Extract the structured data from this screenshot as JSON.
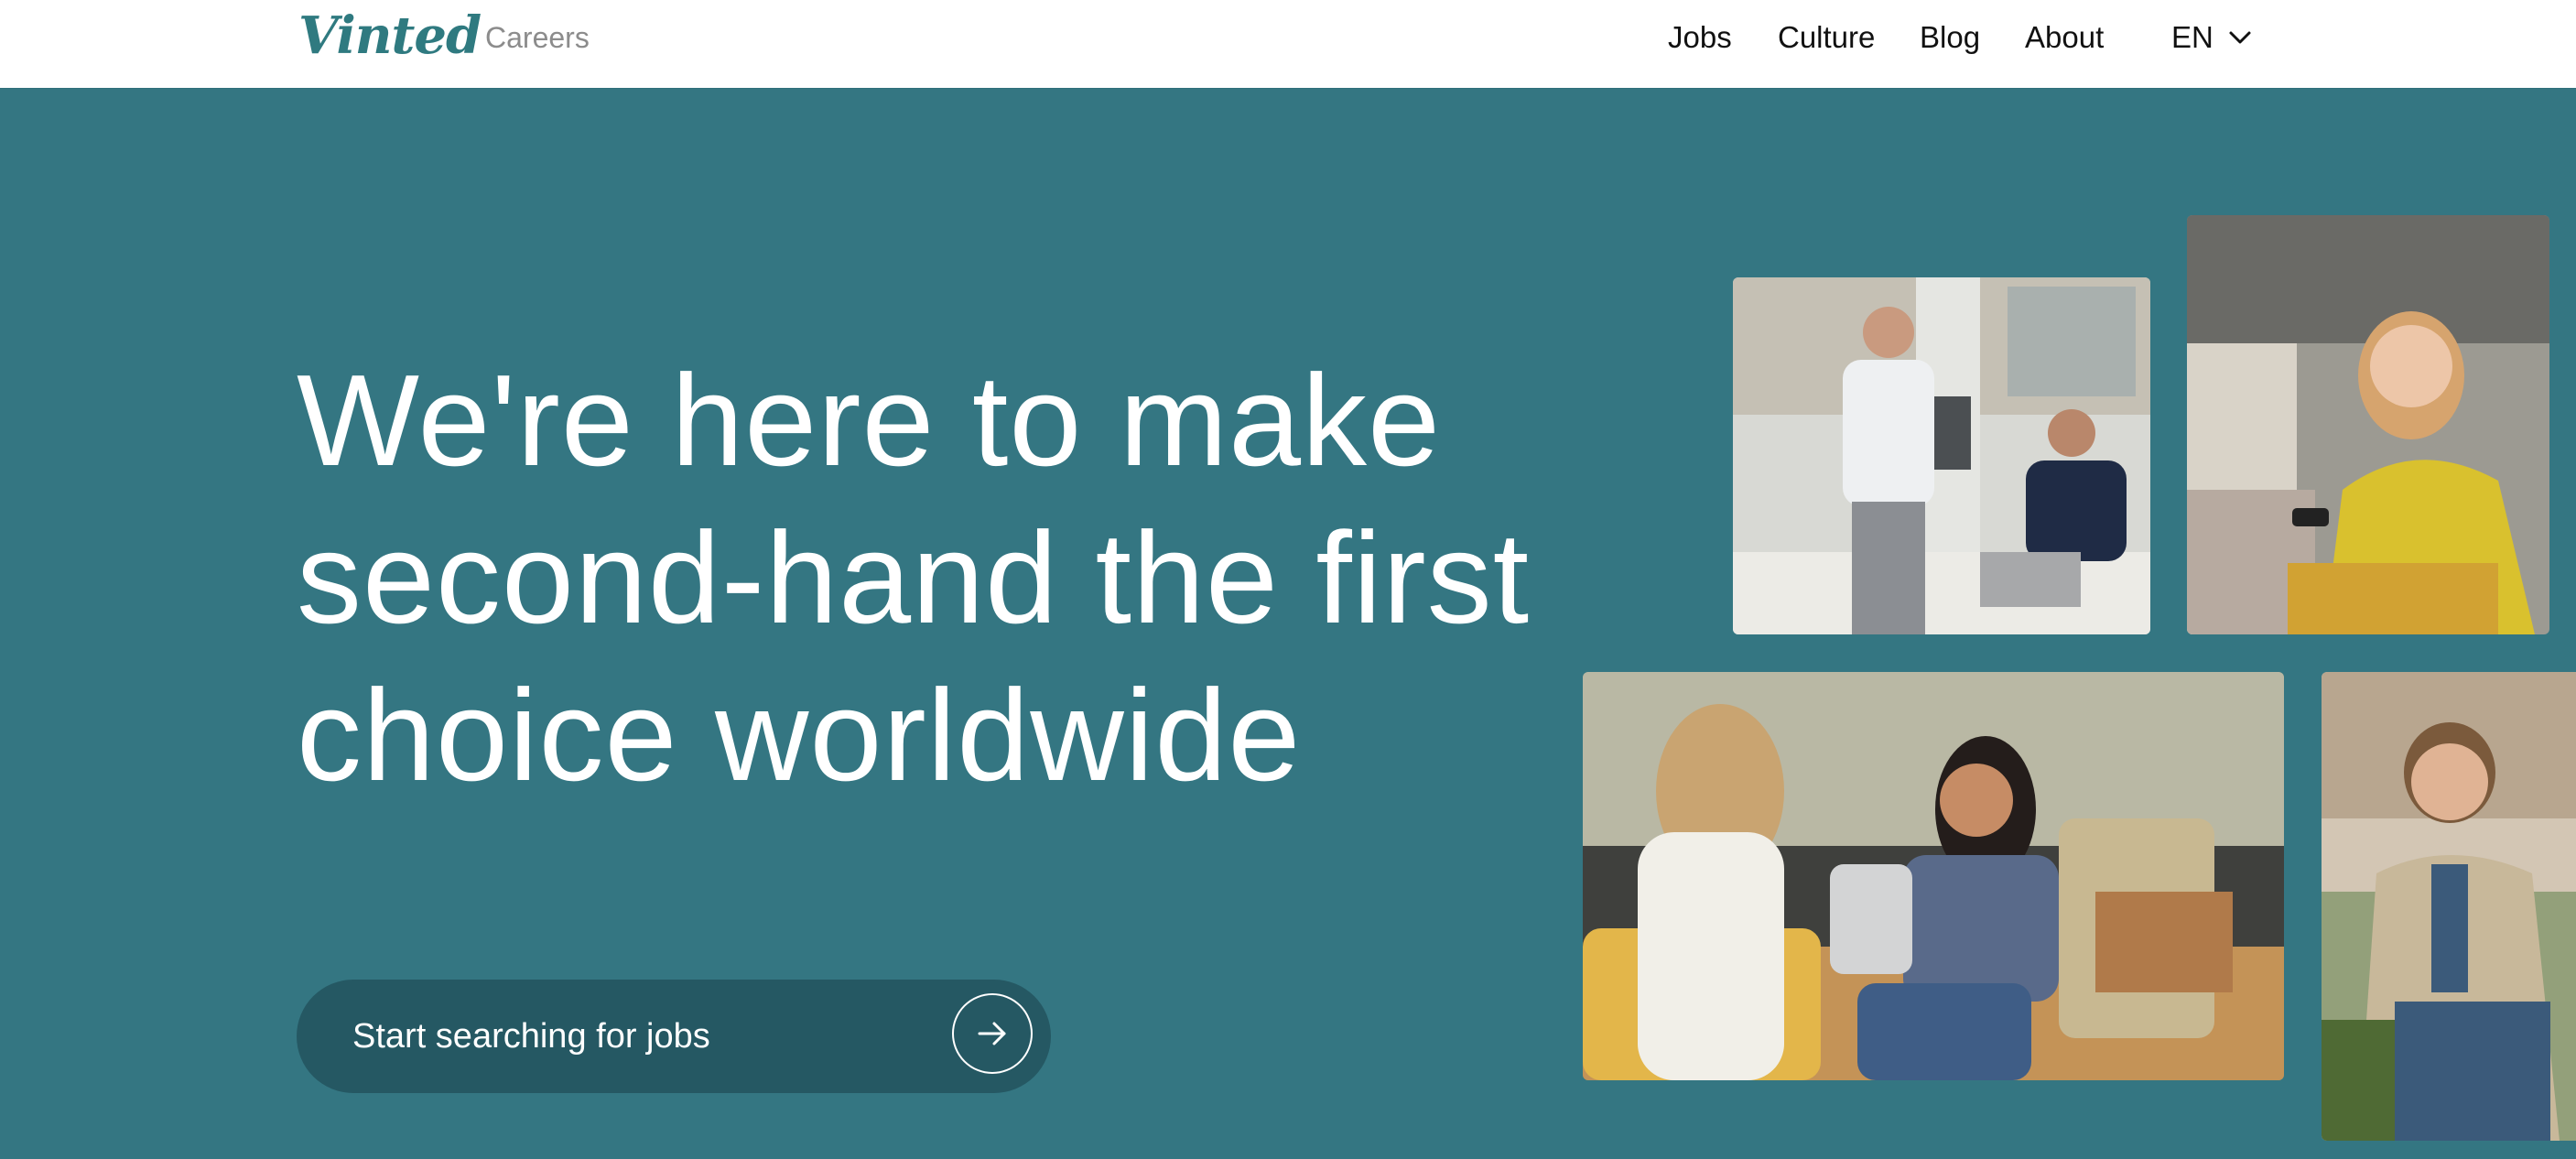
{
  "header": {
    "logo": "Vinted",
    "section": "Careers",
    "nav": [
      {
        "label": "Jobs"
      },
      {
        "label": "Culture"
      },
      {
        "label": "Blog"
      },
      {
        "label": "About"
      }
    ],
    "language": "EN",
    "language_icon": "chevron-down-icon"
  },
  "hero": {
    "headline_lines": [
      "We're here to make",
      "second-hand the first",
      "choice worldwide"
    ],
    "cta_label": "Start searching for jobs",
    "cta_icon": "arrow-right-icon"
  },
  "colors": {
    "brand": "#2f7a80",
    "hero_bg": "#347682",
    "cta_bg": "#255863"
  }
}
